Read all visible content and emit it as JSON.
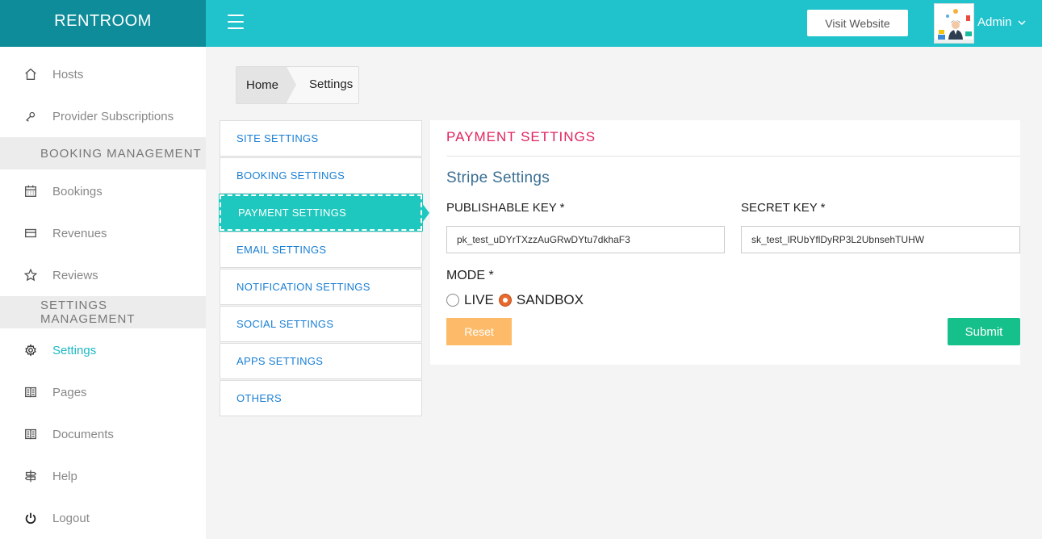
{
  "brand": "RENTROOM",
  "topbar": {
    "visit_website": "Visit Website",
    "user_name": "Admin"
  },
  "sidebar": {
    "items_top": [
      {
        "label": "Hosts",
        "icon": "home-icon"
      },
      {
        "label": "Provider Subscriptions",
        "icon": "key-icon"
      }
    ],
    "section_booking": "BOOKING MANAGEMENT",
    "items_booking": [
      {
        "label": "Bookings",
        "icon": "calendar-icon"
      },
      {
        "label": "Revenues",
        "icon": "credit-card-icon"
      },
      {
        "label": "Reviews",
        "icon": "star-icon"
      }
    ],
    "section_settings": "SETTINGS MANAGEMENT",
    "items_settings": [
      {
        "label": "Settings",
        "icon": "gear-icon",
        "active": true
      },
      {
        "label": "Pages",
        "icon": "book-icon"
      },
      {
        "label": "Documents",
        "icon": "book-icon"
      },
      {
        "label": "Help",
        "icon": "signpost-icon"
      },
      {
        "label": "Logout",
        "icon": "power-icon"
      }
    ]
  },
  "breadcrumb": {
    "home": "Home",
    "current": "Settings"
  },
  "tabs": [
    {
      "label": "SITE SETTINGS"
    },
    {
      "label": "BOOKING SETTINGS"
    },
    {
      "label": "PAYMENT SETTINGS",
      "active": true
    },
    {
      "label": "EMAIL SETTINGS"
    },
    {
      "label": "NOTIFICATION SETTINGS"
    },
    {
      "label": "SOCIAL SETTINGS"
    },
    {
      "label": "APPS SETTINGS"
    },
    {
      "label": "OTHERS"
    }
  ],
  "panel": {
    "title": "PAYMENT SETTINGS",
    "subtitle": "Stripe Settings",
    "publishable_label": "PUBLISHABLE KEY *",
    "publishable_value": "pk_test_uDYrTXzzAuGRwDYtu7dkhaF3",
    "secret_label": "SECRET KEY *",
    "secret_value": "sk_test_lRUbYflDyRP3L2UbnsehTUHW",
    "mode_label": "MODE *",
    "mode_live": "LIVE",
    "mode_sandbox": "SANDBOX",
    "mode_selected": "SANDBOX",
    "reset_label": "Reset",
    "submit_label": "Submit"
  },
  "colors": {
    "brand_bg": "#0e8c9a",
    "topbar_bg": "#20c2cc",
    "active_tab": "#1ec8be",
    "title_pink": "#e0245e",
    "submit": "#16c08a",
    "reset": "#fdbb6a"
  }
}
